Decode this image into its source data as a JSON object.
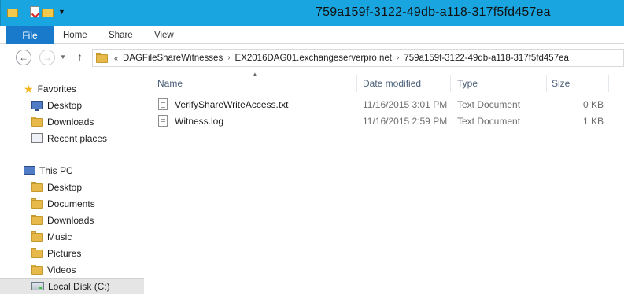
{
  "window": {
    "title": "759a159f-3122-49db-a118-317f5fd457ea"
  },
  "quick_access": {
    "icons": [
      "folder-icon",
      "properties-icon",
      "new-folder-icon",
      "customize-dropdown-icon"
    ]
  },
  "ribbon": {
    "file_tab": "File",
    "tabs": [
      "Home",
      "Share",
      "View"
    ]
  },
  "address": {
    "overflow": "«",
    "crumbs": [
      "DAGFileShareWitnesses",
      "EX2016DAG01.exchangeserverpro.net",
      "759a159f-3122-49db-a118-317f5fd457ea"
    ]
  },
  "nav_pane": {
    "favorites": {
      "label": "Favorites",
      "items": [
        "Desktop",
        "Downloads",
        "Recent places"
      ]
    },
    "this_pc": {
      "label": "This PC",
      "items": [
        "Desktop",
        "Documents",
        "Downloads",
        "Music",
        "Pictures",
        "Videos",
        "Local Disk (C:)"
      ]
    }
  },
  "columns": {
    "name": "Name",
    "date_modified": "Date modified",
    "type": "Type",
    "size": "Size"
  },
  "files": [
    {
      "name": "VerifyShareWriteAccess.txt",
      "date_modified": "11/16/2015 3:01 PM",
      "type": "Text Document",
      "size": "0 KB"
    },
    {
      "name": "Witness.log",
      "date_modified": "11/16/2015 2:59 PM",
      "type": "Text Document",
      "size": "1 KB"
    }
  ],
  "colors": {
    "titlebar": "#19a6e0",
    "file_tab": "#1979ca",
    "header_text": "#4c607a",
    "selected_nav": "#e5e5e5"
  }
}
